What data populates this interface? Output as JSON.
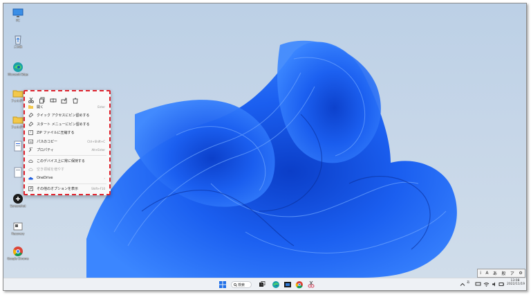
{
  "desktop_icons": [
    {
      "name": "PC",
      "icon": "monitor-icon"
    },
    {
      "name": "ごみ箱",
      "icon": "recycle-bin-icon"
    },
    {
      "name": "Microsoft Edge",
      "icon": "edge-icon"
    },
    {
      "name": "フォルダー",
      "icon": "folder-icon"
    },
    {
      "name": "フォルダー",
      "icon": "folder-icon"
    },
    {
      "name": "",
      "icon": "document-icon"
    },
    {
      "name": "",
      "icon": "document-icon"
    },
    {
      "name": "Screenshot",
      "icon": "app-icon"
    },
    {
      "name": "Recovery",
      "icon": "app-icon"
    },
    {
      "name": "Google Chrome",
      "icon": "chrome-icon"
    }
  ],
  "context_menu": {
    "quick_actions": [
      "cut-icon",
      "copy-icon",
      "rename-icon",
      "share-icon",
      "delete-icon"
    ],
    "items": [
      {
        "label": "開く",
        "shortcut": "Enter",
        "icon": "open-icon"
      },
      {
        "label": "クイック アクセスにピン留めする",
        "shortcut": "",
        "icon": "pin-icon"
      },
      {
        "label": "スタート メニューにピン留めする",
        "shortcut": "",
        "icon": "pin-icon"
      },
      {
        "label": "ZIP ファイルに圧縮する",
        "shortcut": "",
        "icon": "zip-icon"
      },
      {
        "label": "パスのコピー",
        "shortcut": "Ctrl+Shift+C",
        "icon": "path-icon"
      },
      {
        "label": "プロパティ",
        "shortcut": "Alt+Enter",
        "icon": "wrench-icon"
      },
      {
        "label": "このデバイス上に常に保持する",
        "shortcut": "",
        "icon": "cloud-keep-icon"
      },
      {
        "label": "空き領域を増やす",
        "shortcut": "",
        "icon": "cloud-free-icon"
      },
      {
        "label": "OneDrive",
        "shortcut": "›",
        "icon": "onedrive-icon"
      },
      {
        "label": "その他のオプションを表示",
        "shortcut": "Shift+F10",
        "icon": "more-options-icon"
      }
    ]
  },
  "taskbar": {
    "search_label": "検索",
    "apps": [
      "start-icon",
      "task-view-icon",
      "edge-icon",
      "store-icon",
      "explorer-icon",
      "chrome-icon",
      "snip-icon"
    ],
    "time": "13:08",
    "date": "2022/11/19"
  },
  "ime_toolbar": {
    "items": [
      "i",
      "A",
      "あ",
      "般",
      "ア",
      "⚙"
    ]
  },
  "colors": {
    "accent": "#1f5fe0",
    "menu_border": "#e0212b"
  }
}
